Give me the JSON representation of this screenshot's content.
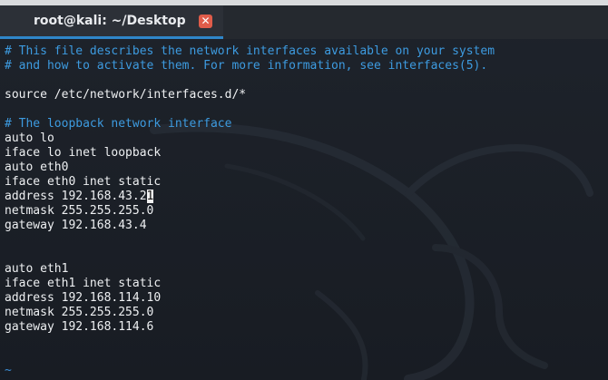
{
  "window": {
    "tab_title": "root@kali: ~/Desktop",
    "close_glyph": "✕"
  },
  "editor": {
    "lines": [
      {
        "type": "comment",
        "text": "# This file describes the network interfaces available on your system"
      },
      {
        "type": "comment",
        "text": "# and how to activate them. For more information, see interfaces(5)."
      },
      {
        "type": "text",
        "text": ""
      },
      {
        "type": "text",
        "text": "source /etc/network/interfaces.d/*"
      },
      {
        "type": "text",
        "text": ""
      },
      {
        "type": "comment",
        "text": "# The loopback network interface"
      },
      {
        "type": "text",
        "text": "auto lo"
      },
      {
        "type": "text",
        "text": "iface lo inet loopback"
      },
      {
        "type": "text",
        "text": "auto eth0"
      },
      {
        "type": "text",
        "text": "iface eth0 inet static"
      },
      {
        "type": "cursor",
        "before": "address 192.168.43.2",
        "cursor_char": "1",
        "after": ""
      },
      {
        "type": "text",
        "text": "netmask 255.255.255.0"
      },
      {
        "type": "text",
        "text": "gateway 192.168.43.4"
      },
      {
        "type": "text",
        "text": ""
      },
      {
        "type": "text",
        "text": ""
      },
      {
        "type": "text",
        "text": "auto eth1"
      },
      {
        "type": "text",
        "text": "iface eth1 inet static"
      },
      {
        "type": "text",
        "text": "address 192.168.114.10"
      },
      {
        "type": "text",
        "text": "netmask 255.255.255.0"
      },
      {
        "type": "text",
        "text": "gateway 192.168.114.6"
      },
      {
        "type": "text",
        "text": ""
      },
      {
        "type": "text",
        "text": ""
      },
      {
        "type": "tilde",
        "text": "~"
      },
      {
        "type": "tilde",
        "text": "~"
      }
    ]
  },
  "colors": {
    "comment": "#3d9be0",
    "text": "#eef0f2",
    "tilde": "#3b8ed6",
    "tab_accent": "#2f86c9",
    "close_button": "#e05c4a",
    "background": "#1a1f27"
  },
  "icons": {
    "close": "close-icon",
    "watermark": "kali-dragon-watermark"
  }
}
